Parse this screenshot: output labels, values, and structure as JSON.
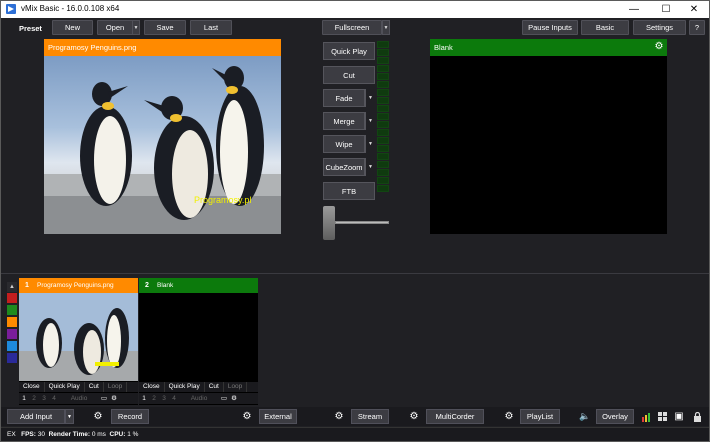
{
  "window": {
    "title": "vMix Basic - 16.0.0.108 x64",
    "minimize": "—",
    "maximize": "☐",
    "close": "✕"
  },
  "toolbar": {
    "preset_label": "Preset",
    "new_label": "New",
    "open_label": "Open",
    "save_label": "Save",
    "last_label": "Last",
    "fullscreen_label": "Fullscreen",
    "pause_inputs_label": "Pause Inputs",
    "basic_label": "Basic",
    "settings_label": "Settings",
    "help_label": "?"
  },
  "preview": {
    "title": "Programosy Penguins.png",
    "watermark": "Programosy.pl"
  },
  "output": {
    "title": "Blank"
  },
  "transitions": {
    "quick_play": "Quick Play",
    "cut": "Cut",
    "fade": "Fade",
    "merge": "Merge",
    "wipe": "Wipe",
    "cubezoom": "CubeZoom",
    "ftb": "FTB",
    "tbar_position": 0
  },
  "color_strip": [
    "#c41e1e",
    "#1e8a1e",
    "#ff8a00",
    "#7a1e9a",
    "#1e8adc",
    "#2a2a9a"
  ],
  "inputs": [
    {
      "number": "1",
      "name": "Programosy Penguins.png",
      "header_color": "#ff8a00",
      "controls": [
        "Close",
        "Quick Play",
        "Cut",
        "Loop"
      ],
      "overlays": [
        "1",
        "2",
        "3",
        "4"
      ],
      "audio": "Audio"
    },
    {
      "number": "2",
      "name": "Blank",
      "header_color": "#0c7a0c",
      "controls": [
        "Close",
        "Quick Play",
        "Cut",
        "Loop"
      ],
      "overlays": [
        "1",
        "2",
        "3",
        "4"
      ],
      "audio": "Audio"
    }
  ],
  "bottom": {
    "add_input": "Add Input",
    "record": "Record",
    "external": "External",
    "stream": "Stream",
    "multicorder": "MultiCorder",
    "playlist": "PlayList",
    "overlay": "Overlay"
  },
  "status": {
    "ex": "EX",
    "fps_label": "FPS:",
    "fps_value": "30",
    "render_label": "Render Time:",
    "render_value": "0 ms",
    "cpu_label": "CPU:",
    "cpu_value": "1 %"
  }
}
